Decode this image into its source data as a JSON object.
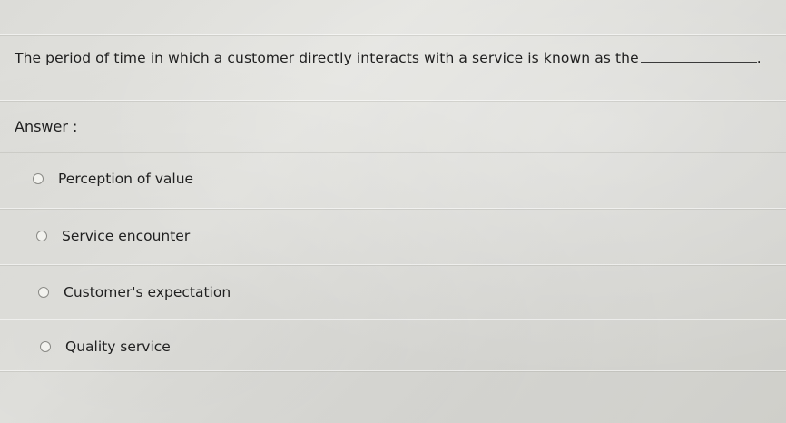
{
  "question": {
    "text": "The period of time in which a customer directly interacts with a service is known as the",
    "trailing_punct": "."
  },
  "answer_label": "Answer :",
  "options": [
    {
      "label": "Perception of value",
      "selected": false
    },
    {
      "label": "Service encounter",
      "selected": false
    },
    {
      "label": "Customer's expectation",
      "selected": false
    },
    {
      "label": "Quality service",
      "selected": false
    }
  ]
}
